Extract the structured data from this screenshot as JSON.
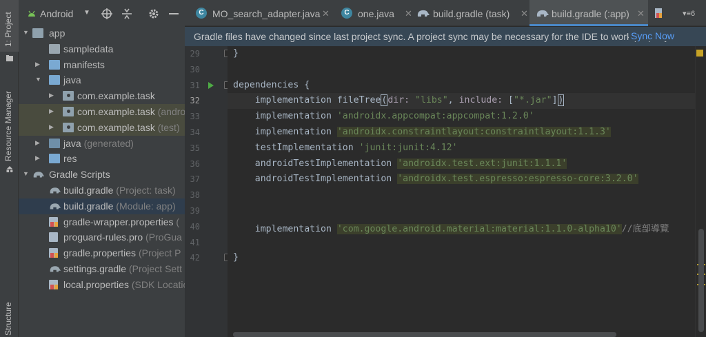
{
  "toolstrip": {
    "project_tab": "1: Project",
    "resource_tab": "Resource Manager",
    "structure_tab": "Structure"
  },
  "project_panel": {
    "title": "Android",
    "tree": [
      {
        "label": "app",
        "hint": "",
        "level": 0,
        "expanded": true
      },
      {
        "label": "sampledata",
        "hint": "",
        "level": 1,
        "expanded": null
      },
      {
        "label": "manifests",
        "hint": "",
        "level": 1,
        "expanded": false
      },
      {
        "label": "java",
        "hint": "",
        "level": 1,
        "expanded": true
      },
      {
        "label": "com.example.task",
        "hint": "",
        "level": 2,
        "expanded": false
      },
      {
        "label": "com.example.task",
        "hint": " (andro",
        "level": 2,
        "expanded": false
      },
      {
        "label": "com.example.task",
        "hint": " (test)",
        "level": 2,
        "expanded": false
      },
      {
        "label": "java",
        "hint": " (generated)",
        "level": 1,
        "expanded": false
      },
      {
        "label": "res",
        "hint": "",
        "level": 1,
        "expanded": false
      },
      {
        "label": "Gradle Scripts",
        "hint": "",
        "level": 0,
        "expanded": true
      },
      {
        "label": "build.gradle",
        "hint": " (Project: task)",
        "level": 1,
        "expanded": null
      },
      {
        "label": "build.gradle",
        "hint": " (Module: app)",
        "level": 1,
        "expanded": null
      },
      {
        "label": "gradle-wrapper.properties",
        "hint": " (",
        "level": 1,
        "expanded": null
      },
      {
        "label": "proguard-rules.pro",
        "hint": " (ProGua",
        "level": 1,
        "expanded": null
      },
      {
        "label": "gradle.properties",
        "hint": " (Project P",
        "level": 1,
        "expanded": null
      },
      {
        "label": "settings.gradle",
        "hint": " (Project Sett",
        "level": 1,
        "expanded": null
      },
      {
        "label": "local.properties",
        "hint": " (SDK Locatio",
        "level": 1,
        "expanded": null
      }
    ]
  },
  "tabs": [
    {
      "label": "MO_search_adapter.java",
      "icon": "class-icon",
      "active": false
    },
    {
      "label": "one.java",
      "icon": "class-icon",
      "active": false
    },
    {
      "label": "build.gradle (task)",
      "icon": "gradle-elephant-icon",
      "active": false
    },
    {
      "label": "build.gradle (:app)",
      "icon": "gradle-elephant-icon",
      "active": true
    }
  ],
  "tab_overflow_count": "6",
  "banner": {
    "message": "Gradle files have changed since last project sync. A project sync may be necessary for the IDE to work properly.",
    "action": "Sync Now"
  },
  "editor": {
    "current_line": "32",
    "lines": [
      {
        "num": "29",
        "text": "}"
      },
      {
        "num": "30",
        "text": ""
      },
      {
        "num": "31",
        "text": "dependencies {"
      },
      {
        "num": "32",
        "pre": "    implementation fileTree",
        "p1": "dir: ",
        "s1": "\"libs\"",
        "mid": ", ",
        "p2": "include: ",
        "b1": "[",
        "s2": "\"*.jar\"",
        "b2": "]"
      },
      {
        "num": "33",
        "pre": "    implementation ",
        "str": "'androidx.appcompat:appcompat:1.2.0'"
      },
      {
        "num": "34",
        "pre": "    implementation ",
        "str": "'androidx.constraintlayout:constraintlayout:1.1.3'"
      },
      {
        "num": "35",
        "pre": "    testImplementation ",
        "str": "'junit:junit:4.12'"
      },
      {
        "num": "36",
        "pre": "    androidTestImplementation ",
        "str": "'androidx.test.ext:junit:1.1.1'"
      },
      {
        "num": "37",
        "pre": "    androidTestImplementation ",
        "str": "'androidx.test.espresso:espresso-core:3.2.0'"
      },
      {
        "num": "38",
        "text": ""
      },
      {
        "num": "39",
        "text": ""
      },
      {
        "num": "40",
        "pre": "    implementation ",
        "str": "'com.google.android.material:material:1.1.0-alpha10'",
        "comment": "//底部導覽"
      },
      {
        "num": "41",
        "text": ""
      },
      {
        "num": "42",
        "text": "}"
      }
    ]
  },
  "colors": {
    "keyword": "#a9b7c6",
    "string": "#6a8759",
    "comment": "#808080",
    "accent": "#4a88c7",
    "link": "#589df6"
  }
}
